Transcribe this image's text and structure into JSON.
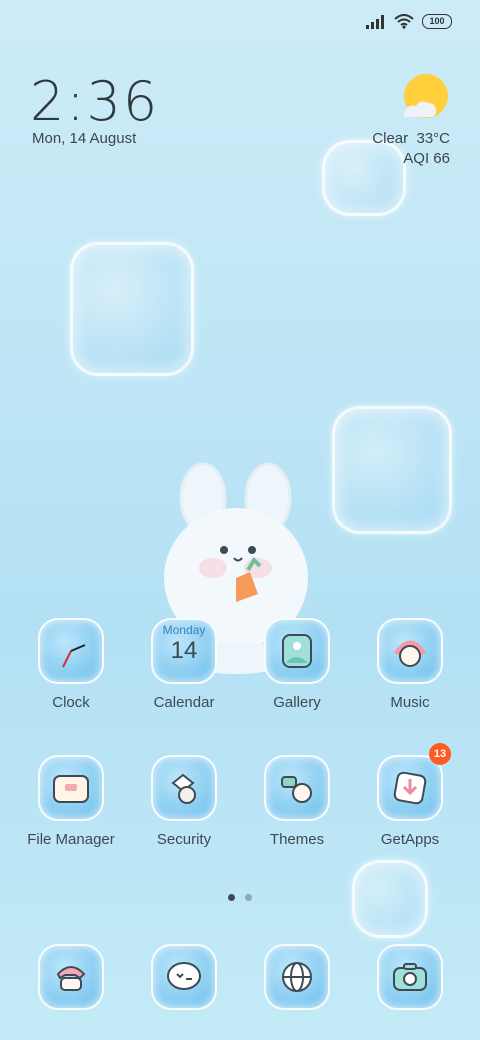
{
  "status_bar": {
    "battery": "100",
    "signal_icon": "signal-icon",
    "wifi_icon": "wifi-icon"
  },
  "clock_widget": {
    "time": "2:36",
    "date": "Mon, 14 August"
  },
  "weather": {
    "condition": "Clear",
    "temperature": "33°C",
    "aqi": "AQI 66",
    "icon": "sun-cloud-icon"
  },
  "calendar_icon": {
    "day_name": "Monday",
    "day_number": "14"
  },
  "apps_row1": [
    {
      "label": "Clock",
      "icon": "clock-icon"
    },
    {
      "label": "Calendar",
      "icon": "calendar-icon"
    },
    {
      "label": "Gallery",
      "icon": "gallery-icon"
    },
    {
      "label": "Music",
      "icon": "music-icon"
    }
  ],
  "apps_row2": [
    {
      "label": "File Manager",
      "icon": "folder-icon"
    },
    {
      "label": "Security",
      "icon": "shield-icon"
    },
    {
      "label": "Themes",
      "icon": "themes-icon"
    },
    {
      "label": "GetApps",
      "icon": "download-icon",
      "badge": "13"
    }
  ],
  "dock": [
    {
      "icon": "phone-icon"
    },
    {
      "icon": "message-icon"
    },
    {
      "icon": "browser-icon"
    },
    {
      "icon": "camera-icon"
    }
  ],
  "page_indicator": {
    "pages": 2,
    "active_index": 0
  },
  "colors": {
    "badge": "#ff5a1f",
    "sun": "#ffcf3c",
    "background": "#bfe6f6"
  }
}
